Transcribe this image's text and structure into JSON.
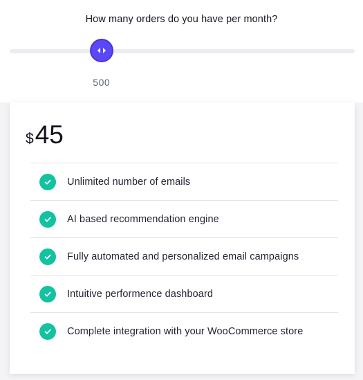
{
  "slider": {
    "question": "How many orders do you have per month?",
    "value": "500",
    "position_fraction": 0.266,
    "accent_color": "#5b47f5"
  },
  "pricing": {
    "currency": "$",
    "amount": "45"
  },
  "features": [
    {
      "icon": "check-circle-icon",
      "label": "Unlimited number of emails"
    },
    {
      "icon": "check-circle-icon",
      "label": "AI based recommendation engine"
    },
    {
      "icon": "check-circle-icon",
      "label": "Fully automated and personalized email campaigns"
    },
    {
      "icon": "check-circle-icon",
      "label": "Intuitive performence dashboard"
    },
    {
      "icon": "check-circle-icon",
      "label": "Complete integration with your WooCommerce store"
    }
  ],
  "colors": {
    "check": "#12c2a0"
  }
}
